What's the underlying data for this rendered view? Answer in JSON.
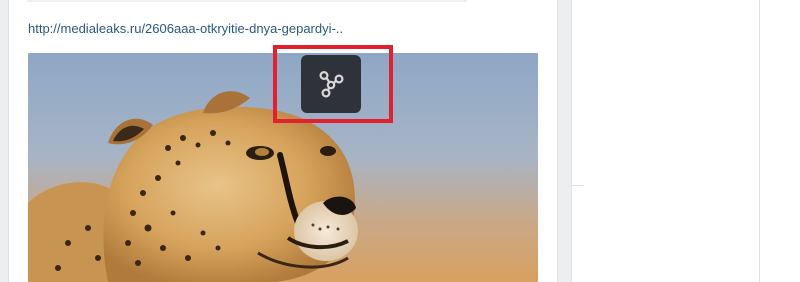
{
  "post": {
    "link_text": "http://medialeaks.ru/2606aaa-otkryitie-dnya-gepardyi-..",
    "image_icon": "cheetah-photo",
    "share_icon": "fidget-spinner-icon"
  },
  "colors": {
    "link": "#2a5885",
    "highlight": "#e3212e",
    "overlay": "#26282c",
    "page_background": "#edeef0"
  }
}
